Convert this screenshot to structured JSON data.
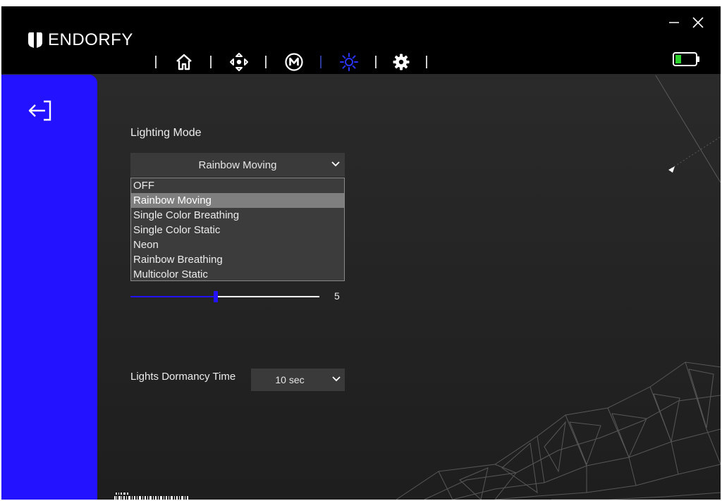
{
  "app": {
    "brand": "ENDORFY"
  },
  "nav": {
    "items": [
      {
        "id": "home",
        "icon": "home-icon",
        "active": false
      },
      {
        "id": "buttons",
        "icon": "dpad-icon",
        "active": false
      },
      {
        "id": "macro",
        "icon": "macro-m-icon",
        "active": false
      },
      {
        "id": "lighting",
        "icon": "lighting-sun-icon",
        "active": true
      },
      {
        "id": "settings",
        "icon": "gear-icon",
        "active": false
      }
    ]
  },
  "lighting": {
    "mode_label": "Lighting Mode",
    "mode_selected": "Rainbow Moving",
    "options": [
      "OFF",
      "Rainbow Moving",
      "Single Color Breathing",
      "Single Color Static",
      "Neon",
      "Rainbow Breathing",
      "Multicolor Static"
    ],
    "selected_index": 1,
    "slider_value": "5",
    "slider_fraction": 0.45,
    "dormancy_label": "Lights Dormancy Time",
    "dormancy_value": "10 sec"
  },
  "colors": {
    "accent": "#2212ff",
    "battery": "#2ed12e",
    "background": "#262626",
    "titlebar": "#000000"
  }
}
